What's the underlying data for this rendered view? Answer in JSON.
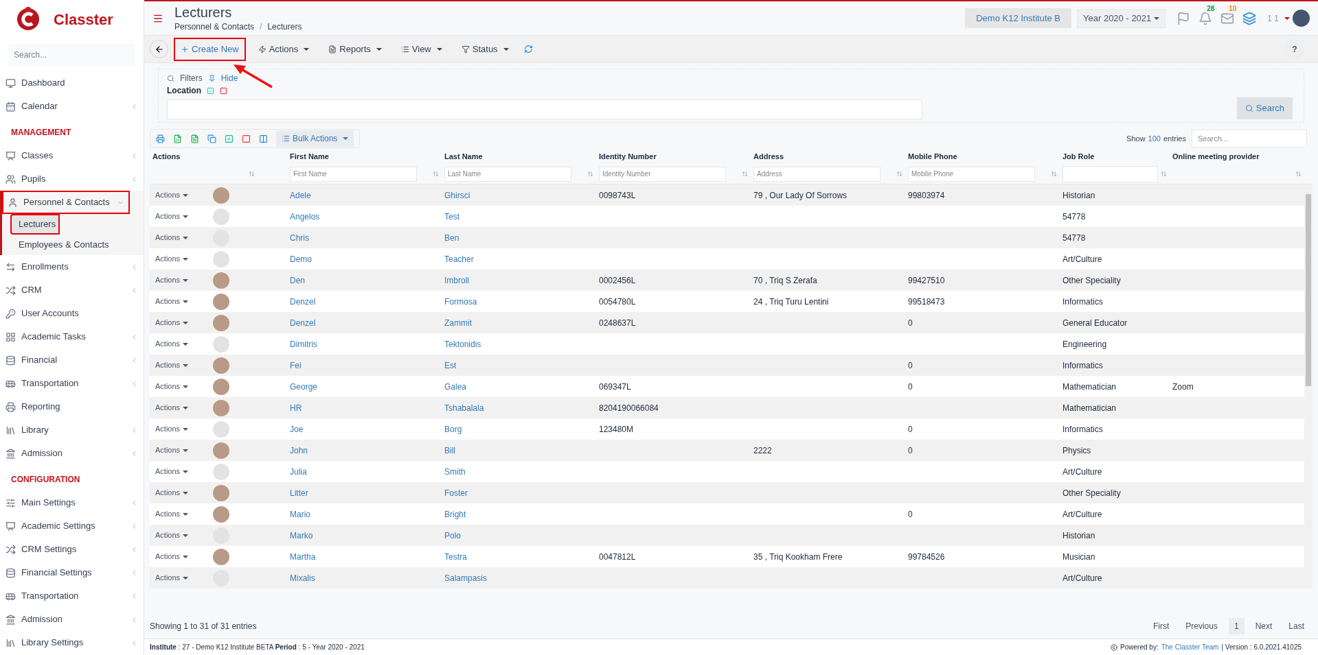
{
  "brand": {
    "name": "Classter"
  },
  "sidebar": {
    "search": {
      "placeholder": "Search..."
    },
    "items": [
      {
        "kind": "item",
        "label": "Dashboard",
        "has_submenu": false
      },
      {
        "kind": "item",
        "label": "Calendar",
        "has_submenu": true
      },
      {
        "kind": "section",
        "label": "MANAGEMENT"
      },
      {
        "kind": "item",
        "label": "Classes",
        "has_submenu": true
      },
      {
        "kind": "item",
        "label": "Pupils",
        "has_submenu": true
      },
      {
        "kind": "item",
        "label": "Personnel & Contacts",
        "has_submenu": true,
        "expanded": true,
        "annotated": true,
        "children": [
          {
            "label": "Lecturers",
            "selected": true,
            "annotated": true
          },
          {
            "label": "Employees & Contacts",
            "selected": false,
            "annotated": false
          }
        ]
      },
      {
        "kind": "item",
        "label": "Enrollments",
        "has_submenu": true
      },
      {
        "kind": "item",
        "label": "CRM",
        "has_submenu": true
      },
      {
        "kind": "item",
        "label": "User Accounts",
        "has_submenu": false
      },
      {
        "kind": "item",
        "label": "Academic Tasks",
        "has_submenu": true
      },
      {
        "kind": "item",
        "label": "Financial",
        "has_submenu": true
      },
      {
        "kind": "item",
        "label": "Transportation",
        "has_submenu": true
      },
      {
        "kind": "item",
        "label": "Reporting",
        "has_submenu": false
      },
      {
        "kind": "item",
        "label": "Library",
        "has_submenu": true
      },
      {
        "kind": "item",
        "label": "Admission",
        "has_submenu": true
      },
      {
        "kind": "section",
        "label": "CONFIGURATION"
      },
      {
        "kind": "item",
        "label": "Main Settings",
        "has_submenu": true
      },
      {
        "kind": "item",
        "label": "Academic Settings",
        "has_submenu": true
      },
      {
        "kind": "item",
        "label": "CRM Settings",
        "has_submenu": true
      },
      {
        "kind": "item",
        "label": "Financial Settings",
        "has_submenu": true
      },
      {
        "kind": "item",
        "label": "Transportation",
        "has_submenu": true
      },
      {
        "kind": "item",
        "label": "Admission",
        "has_submenu": true
      },
      {
        "kind": "item",
        "label": "Library Settings",
        "has_submenu": true
      }
    ]
  },
  "header": {
    "title": "Lecturers",
    "breadcrumb": [
      "Personnel & Contacts",
      "Lecturers"
    ],
    "breadcrumb_separator": "/",
    "institute": "Demo K12 Institute B",
    "year": "Year 2020 - 2021",
    "notifications": "28",
    "messages": "10",
    "user": "1 1"
  },
  "toolbar": {
    "buttons": [
      {
        "label": "Create New",
        "annotated": true,
        "dropdown": false
      },
      {
        "label": "Actions",
        "annotated": false,
        "dropdown": true
      },
      {
        "label": "Reports",
        "annotated": false,
        "dropdown": true
      },
      {
        "label": "View",
        "annotated": false,
        "dropdown": true
      },
      {
        "label": "Status",
        "annotated": false,
        "dropdown": true
      }
    ],
    "help": "?"
  },
  "filters": {
    "title": "Filters",
    "hide": "Hide",
    "field_label": "Location",
    "search_button": "Search"
  },
  "table_tools": {
    "bulk_actions": "Bulk Actions",
    "show": "Show",
    "entries_count": "100",
    "entries": "entries",
    "search": {
      "placeholder": "Search..."
    }
  },
  "table": {
    "columns": [
      "Actions",
      "First Name",
      "Last Name",
      "Identity Number",
      "Address",
      "Mobile Phone",
      "Job Role",
      "Online meeting provider"
    ],
    "column_filters": [
      {
        "kind": "text",
        "placeholder": "First Name"
      },
      {
        "kind": "text",
        "placeholder": "Last Name"
      },
      {
        "kind": "text",
        "placeholder": "Identity Number"
      },
      {
        "kind": "text",
        "placeholder": "Address"
      },
      {
        "kind": "text",
        "placeholder": "Mobile Phone"
      },
      {
        "kind": "select"
      }
    ],
    "rows": [
      {
        "action": "Actions",
        "kind": "photo",
        "first": "Adele",
        "last": "Ghirsci",
        "id": "0098743L",
        "address": "79 , Our Lady Of Sorrows",
        "mobile": "99803974",
        "role": "Historian"
      },
      {
        "action": "Actions",
        "kind": "placeholder",
        "first": "Angelos",
        "last": "Test",
        "role": "54778"
      },
      {
        "action": "Actions",
        "kind": "placeholder",
        "first": "Chris",
        "last": "Ben",
        "role": "54778"
      },
      {
        "action": "Actions",
        "kind": "placeholder",
        "first": "Demo",
        "last": "Teacher",
        "role": "Art/Culture"
      },
      {
        "action": "Actions",
        "kind": "photo",
        "first": "Den",
        "last": "Imbroll",
        "id": "0002456L",
        "address": "70 , Triq S Zerafa",
        "mobile": "99427510",
        "role": "Other Speciality"
      },
      {
        "action": "Actions",
        "kind": "photo",
        "first": "Denzel",
        "last": "Formosa",
        "id": "0054780L",
        "address": "24 , Triq Turu Lentini",
        "mobile": "99518473",
        "role": "Informatics"
      },
      {
        "action": "Actions",
        "kind": "photo",
        "first": "Denzel",
        "last": "Zammit",
        "id": "0248637L",
        "mobile": "0",
        "role": "General Educator"
      },
      {
        "action": "Actions",
        "kind": "placeholder",
        "first": "Dimitris",
        "last": "Tektonidis",
        "role": "Engineering"
      },
      {
        "action": "Actions",
        "kind": "photo",
        "first": "Fei",
        "last": "Est",
        "mobile": "0",
        "role": "Informatics"
      },
      {
        "action": "Actions",
        "kind": "photo",
        "first": "George",
        "last": "Galea",
        "id": "069347L",
        "mobile": "0",
        "role": "Mathematician",
        "provider": "Zoom"
      },
      {
        "action": "Actions",
        "kind": "photo",
        "first": "HR",
        "last": "Tshabalala",
        "id": "8204190066084",
        "role": "Mathematician"
      },
      {
        "action": "Actions",
        "kind": "placeholder",
        "first": "Joe",
        "last": "Borg",
        "id": "123480M",
        "mobile": "0",
        "role": "Informatics"
      },
      {
        "action": "Actions",
        "kind": "photo",
        "first": "John",
        "last": "Bill",
        "address": "2222",
        "mobile": "0",
        "role": "Physics"
      },
      {
        "action": "Actions",
        "kind": "placeholder",
        "first": "Julia",
        "last": "Smith",
        "role": "Art/Culture"
      },
      {
        "action": "Actions",
        "kind": "photo",
        "first": "Litter",
        "last": "Foster",
        "role": "Other Speciality"
      },
      {
        "action": "Actions",
        "kind": "photo",
        "first": "Mario",
        "last": "Bright",
        "mobile": "0",
        "role": "Art/Culture"
      },
      {
        "action": "Actions",
        "kind": "placeholder",
        "first": "Marko",
        "last": "Polo",
        "role": "Historian"
      },
      {
        "action": "Actions",
        "kind": "photo",
        "first": "Martha",
        "last": "Testra",
        "id": "0047812L",
        "address": "35 , Triq Kookham Frere",
        "mobile": "99784526",
        "role": "Musician"
      },
      {
        "action": "Actions",
        "kind": "placeholder",
        "first": "Mixalis",
        "last": "Salampasis",
        "role": "Art/Culture"
      }
    ]
  },
  "pagination": {
    "info": "Showing 1 to 31 of 31 entries",
    "pages": [
      {
        "label": "First",
        "selected": false
      },
      {
        "label": "Previous",
        "selected": false
      },
      {
        "label": "1",
        "selected": true
      },
      {
        "label": "Next",
        "selected": false
      },
      {
        "label": "Last",
        "selected": false
      }
    ]
  },
  "footer": {
    "info": "**Institute** : 27 - Demo K12 Institute BETA **Period** : 5 - Year 2020 - 2021",
    "powered": "Powered by:",
    "team": "The Classter Team",
    "version": "| Version : 6.0.2021.41025"
  }
}
